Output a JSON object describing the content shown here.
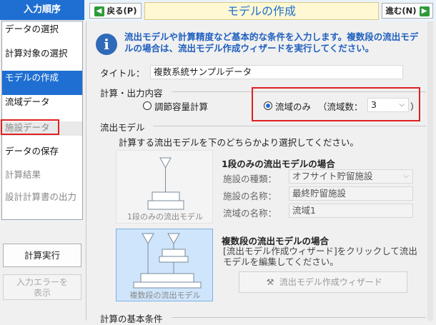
{
  "sidebar": {
    "header": "入力順序",
    "items": [
      {
        "label": "データの選択"
      },
      {
        "label": "計算対象の選択"
      },
      {
        "label": "モデルの作成"
      },
      {
        "label": "流域データ"
      },
      {
        "label": "施設データ"
      },
      {
        "label": "データの保存"
      },
      {
        "label": "計算結果"
      },
      {
        "label": "設計計算書の出力"
      }
    ],
    "run_button": "計算実行",
    "error_button": "入力エラーを表示"
  },
  "toolbar": {
    "back_label": "戻る(P)",
    "title": "モデルの作成",
    "next_label": "進む(N)"
  },
  "info": {
    "text": "流出モデルや計算精度など基本的な条件を入力します。複数段の流出モデルの場合は、流出モデル作成ウィザードを実行してください。"
  },
  "form": {
    "title_label": "タイトル：",
    "title_value": "複数系統サンプルデータ",
    "calc_section": "計算・出力内容",
    "radio_adjust": "調節容量計算",
    "radio_basin_only": "流域のみ",
    "basin_count_label": "（流域数：",
    "basin_count_value": "3",
    "basin_count_close": "）",
    "model_section": "流出モデル",
    "model_hint": "計算する流出モデルを下のどちらかより選択してください。",
    "single": {
      "caption": "1段のみの流出モデル",
      "heading": "1段のみの流出モデルの場合",
      "type_label": "施設の種類：",
      "type_value": "オフサイト貯留施設",
      "name_label": "施設の名称：",
      "name_value": "最終貯留施設",
      "basin_label": "流域の名称：",
      "basin_value": "流域1"
    },
    "multi": {
      "caption": "複数段の流出モデル",
      "heading": "複数段の流出モデルの場合",
      "desc": "[流出モデル作成ウィザード]をクリックして流出モデルを編集してください。",
      "wizard_button": "流出モデル作成ウィザード"
    },
    "basic_section": "計算の基本条件"
  }
}
